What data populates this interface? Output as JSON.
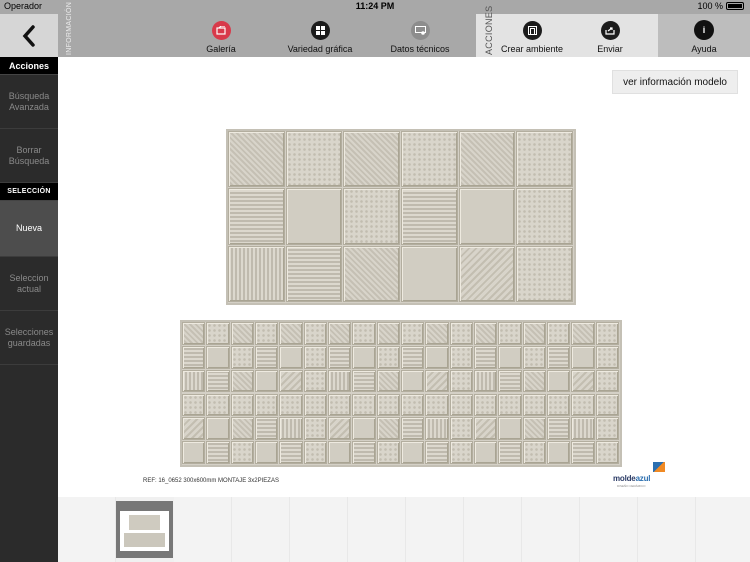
{
  "status": {
    "carrier": "Operador",
    "time": "11:24 PM",
    "battery": "100 %"
  },
  "toolbar": {
    "back_label": "<",
    "info_section": "INFORMACIÓN",
    "actions_section": "ACCIONES",
    "items": {
      "galeria": "Galería",
      "variedad": "Variedad gráfica",
      "datos": "Datos técnicos",
      "crear": "Crear ambiente",
      "enviar": "Enviar",
      "ayuda": "Ayuda"
    }
  },
  "sidebar": {
    "header_acciones": "Acciones",
    "busqueda_avanzada": "Búsqueda Avanzada",
    "borrar_busqueda": "Borrar Búsqueda",
    "header_seleccion": "SELECCIÓN",
    "nueva": "Nueva",
    "seleccion_actual": "Seleccion actual",
    "selecciones_guardadas": "Selecciones guardadas"
  },
  "main": {
    "info_button": "ver información modelo",
    "ref_text": "REF: 16_0652   300x600mm  MONTAJE 3x2PIEZAS",
    "logo_text": "moldeazul",
    "logo_text_a": "molde",
    "logo_text_b": "azul",
    "logo_sub": "DISEÑO CERÁMICO"
  },
  "colors": {
    "toolbar_bg": "#a8a8a8",
    "sidebar_bg": "#2b2b2b",
    "accent_red": "#d8394a",
    "tile_beige": "#d4d0c6"
  },
  "icons": {
    "galeria": "gallery-icon",
    "variedad": "grid-icon",
    "datos": "technical-data-icon",
    "crear": "create-room-icon",
    "enviar": "share-icon",
    "ayuda": "info-icon"
  }
}
